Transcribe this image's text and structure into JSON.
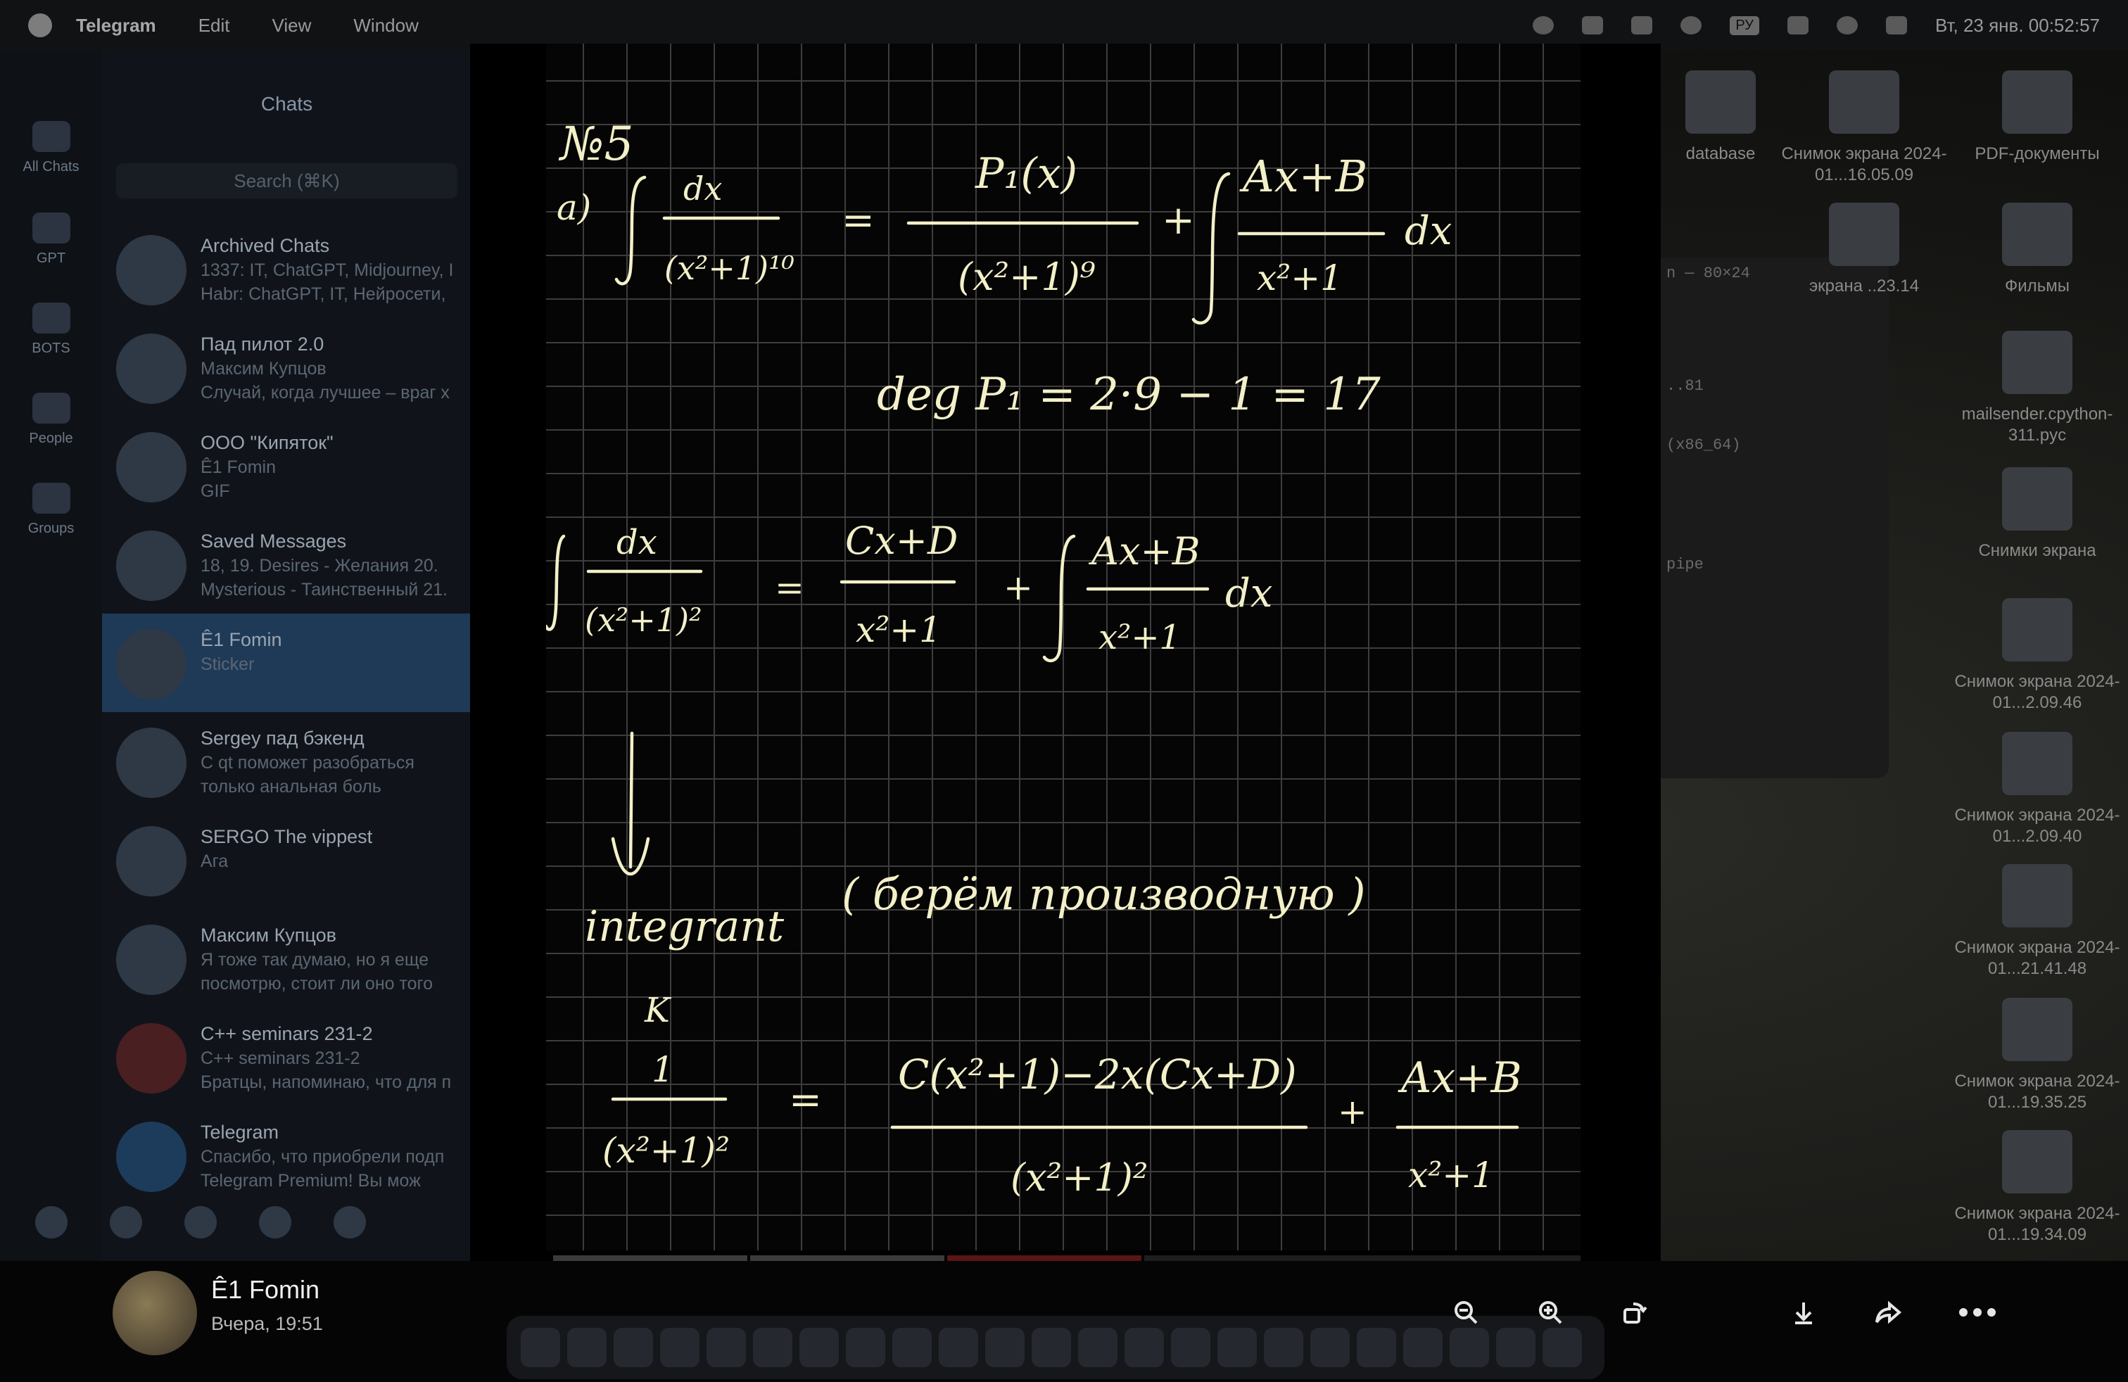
{
  "menubar": {
    "app_name": "Telegram",
    "menus": [
      "Edit",
      "View",
      "Window"
    ],
    "input_lang": "РУ",
    "datetime": "Вт, 23 янв.  00:52:57"
  },
  "telegram": {
    "rail": [
      {
        "label": "All Chats",
        "icon": "chat-bubbles-icon"
      },
      {
        "label": "GPT",
        "icon": "folder-icon"
      },
      {
        "label": "BOTS",
        "icon": "folder-icon"
      },
      {
        "label": "People",
        "icon": "folder-icon"
      },
      {
        "label": "Groups",
        "icon": "folder-icon"
      }
    ],
    "header": "Chats",
    "search_placeholder": "Search (⌘K)",
    "chats": [
      {
        "name": "Archived Chats",
        "line1": "1337: IT, ChatGPT, Midjourney, I",
        "line2": "Habr: ChatGPT, IT, Нейросети,"
      },
      {
        "name": "Пад пилот 2.0",
        "line1": "Максим Купцов",
        "line2": "Случай, когда лучшее – враг х"
      },
      {
        "name": "ООО \"Кипяток\"",
        "line1": "Ê1 Fomin",
        "line2": "GIF"
      },
      {
        "name": "Saved Messages",
        "line1": "18, 19. Desires - Желания 20.",
        "line2": "Mysterious - Таинственный 21."
      },
      {
        "name": "Ê1 Fomin",
        "line1": "Sticker",
        "line2": ""
      },
      {
        "name": "Sergey пад бэкенд",
        "line1": "С qt поможет разобраться",
        "line2": "только анальная боль"
      },
      {
        "name": "SERGO The vippest",
        "line1": "Ага",
        "line2": ""
      },
      {
        "name": "Максим Купцов",
        "line1": "Я тоже так думаю, но я еще",
        "line2": "посмотрю, стоит ли оно того"
      },
      {
        "name": "C++ seminars 231-2",
        "line1": "C++ seminars 231-2",
        "line2": "Братцы, напоминаю, что для п"
      },
      {
        "name": "Telegram",
        "line1": "Спасибо, что приобрели подп",
        "line2": "Telegram Premium! Вы мож"
      }
    ]
  },
  "terminal": {
    "title": "n — 80×24",
    "lines": [
      "..81",
      "(x86_64)",
      "pipe"
    ]
  },
  "desktop_icons": [
    {
      "label": "database"
    },
    {
      "label": "Снимок экрана 2024-01...16.05.09"
    },
    {
      "label": "PDF-документы"
    },
    {
      "label": "экрана ..23.14"
    },
    {
      "label": "Фильмы"
    },
    {
      "label": "mailsender.cpython-311.pyc"
    },
    {
      "label": "Снимки экрана"
    },
    {
      "label": "Снимок экрана 2024-01...2.09.46"
    },
    {
      "label": "Снимок экрана 2024-01...2.09.40"
    },
    {
      "label": "Снимок экрана 2024-01...21.41.48"
    },
    {
      "label": "Снимок экрана 2024-01...19.35.25"
    },
    {
      "label": "Снимок экрана 2024-01...19.34.09"
    }
  ],
  "handwriting": {
    "problem": "№5",
    "a_label": "a)",
    "a_integrand_num": "dx",
    "a_integrand_den": "(x²+1)¹⁰",
    "a_rhs_num": "P₁(x)",
    "a_rhs_den": "(x²+1)⁹",
    "a_int_num": "Ax+B",
    "a_int_den": "x²+1",
    "dx": "dx",
    "deg_line": "deg P₁ = 2·9 − 1 = 17",
    "b_num": "dx",
    "b_den": "(x²+1)²",
    "b_rhs_num": "Cx+D",
    "b_rhs_den": "x²+1",
    "b_int_num": "Ax+B",
    "b_int_den": "x²+1",
    "arrow_note": "integrant",
    "arrow_comment": "( берём производную )",
    "k_label": "K",
    "c_num": "1",
    "c_den": "(x²+1)²",
    "c_rhs_num": "C(x²+1)−2x(Cx+D)",
    "c_rhs_den": "(x²+1)²",
    "c_last_num": "Ax+B",
    "c_last_den": "x²+1"
  },
  "viewer": {
    "sender": "Ê1 Fomin",
    "time": "Вчера, 19:51",
    "controls": [
      "zoom-out-icon",
      "zoom-in-icon",
      "rotate-icon",
      "download-icon",
      "forward-icon",
      "more-icon"
    ],
    "progress_segments": 3,
    "active_segment": 3
  }
}
